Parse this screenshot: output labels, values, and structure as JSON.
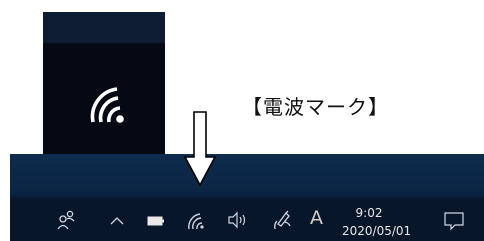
{
  "annotation": {
    "caption": "【電波マーク】"
  },
  "tray": {
    "ime_indicator": "A",
    "time": "9:02",
    "date": "2020/05/01"
  },
  "icons": [
    "people-icon",
    "chevron-up-icon",
    "battery-icon",
    "wifi-icon",
    "speaker-icon",
    "pen-icon",
    "notification-icon"
  ],
  "colors": {
    "taskbar": "#08162a",
    "taskbar_top": "#0e2c4e",
    "tile": "#050913",
    "icon_fg": "#cfd6e0",
    "arrow_stroke": "#000000"
  }
}
